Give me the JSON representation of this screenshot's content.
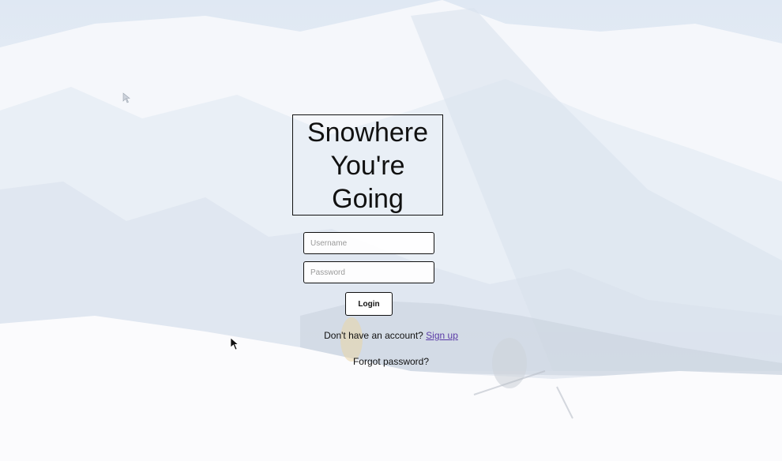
{
  "app": {
    "title_lines": [
      "Snowhere",
      "You're",
      "Going"
    ]
  },
  "form": {
    "username_placeholder": "Username",
    "password_placeholder": "Password",
    "login_label": "Login"
  },
  "links": {
    "signup_prompt": "Don't have an account?",
    "signup_label": "Sign up",
    "forgot_label": "Forgot password?"
  },
  "colors": {
    "link": "#5a3aa6",
    "border": "#111111"
  },
  "icons": [
    "mouse-pointer-icon"
  ]
}
